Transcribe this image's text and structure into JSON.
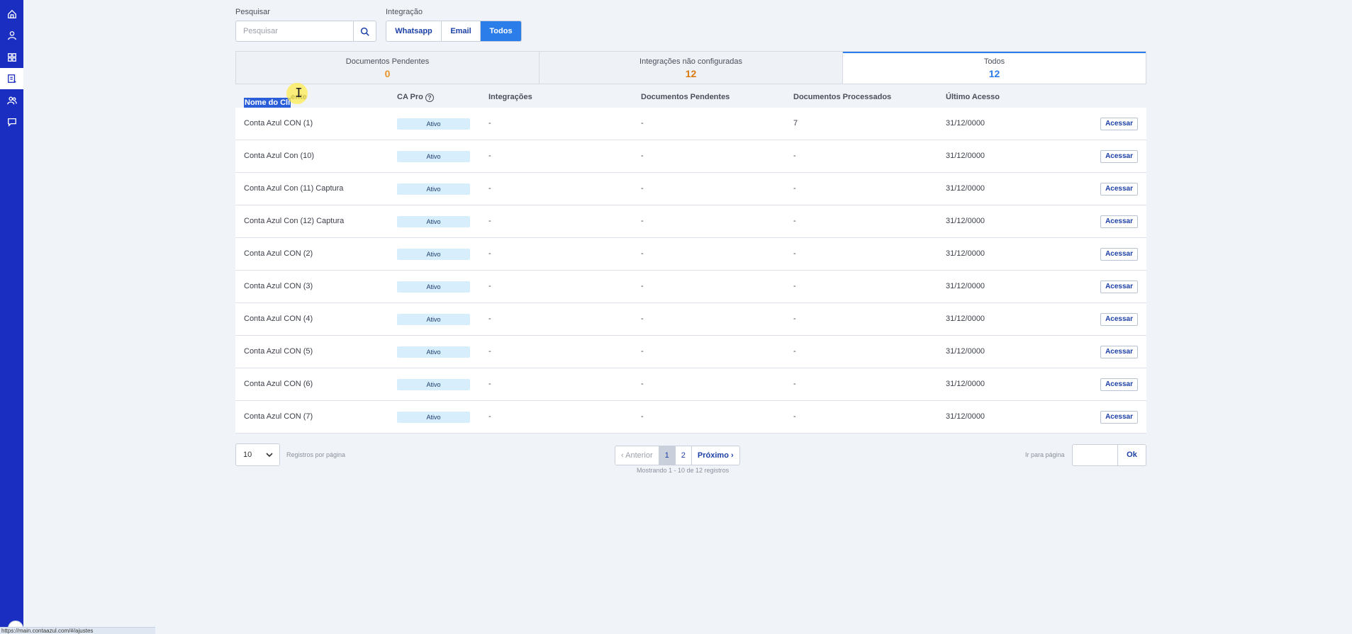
{
  "colors": {
    "sidebar": "#1b2ec2",
    "accent": "#2b7de9",
    "pending_count": "#e8942c",
    "unconfigured_count": "#d9790f",
    "all_count": "#2b7de9",
    "badge_bg": "#d7eefc"
  },
  "sidebar": {
    "items": [
      {
        "icon": "home-icon"
      },
      {
        "icon": "user-icon"
      },
      {
        "icon": "grid-icon"
      },
      {
        "icon": "document-list-icon",
        "active": true
      },
      {
        "icon": "users-icon"
      },
      {
        "icon": "chat-icon"
      }
    ]
  },
  "filters": {
    "search_label": "Pesquisar",
    "search_placeholder": "Pesquisar",
    "integration_label": "Integração",
    "integration_options": [
      {
        "label": "Whatsapp",
        "active": false
      },
      {
        "label": "Email",
        "active": false
      },
      {
        "label": "Todos",
        "active": true
      }
    ]
  },
  "tabs": [
    {
      "title": "Documentos Pendentes",
      "count": "0",
      "active": false
    },
    {
      "title": "Integrações não configuradas",
      "count": "12",
      "active": false
    },
    {
      "title": "Todos",
      "count": "12",
      "active": true
    }
  ],
  "table": {
    "headers": {
      "name_selected": "Nome do Cli",
      "name_rest": "ente",
      "ca_pro": "CA Pro",
      "integracoes": "Integrações",
      "pendentes": "Documentos Pendentes",
      "processados": "Documentos Processados",
      "ultimo_acesso": "Último Acesso"
    },
    "action_label": "Acessar",
    "rows": [
      {
        "name": "Conta Azul CON (1)",
        "ca_pro": "Ativo",
        "integracoes": "-",
        "pendentes": "-",
        "processados": "7",
        "ultimo_acesso": "31/12/0000"
      },
      {
        "name": "Conta Azul Con (10)",
        "ca_pro": "Ativo",
        "integracoes": "-",
        "pendentes": "-",
        "processados": "-",
        "ultimo_acesso": "31/12/0000"
      },
      {
        "name": "Conta Azul Con (11) Captura",
        "ca_pro": "Ativo",
        "integracoes": "-",
        "pendentes": "-",
        "processados": "-",
        "ultimo_acesso": "31/12/0000"
      },
      {
        "name": "Conta Azul Con (12) Captura",
        "ca_pro": "Ativo",
        "integracoes": "-",
        "pendentes": "-",
        "processados": "-",
        "ultimo_acesso": "31/12/0000"
      },
      {
        "name": "Conta Azul CON (2)",
        "ca_pro": "Ativo",
        "integracoes": "-",
        "pendentes": "-",
        "processados": "-",
        "ultimo_acesso": "31/12/0000"
      },
      {
        "name": "Conta Azul CON (3)",
        "ca_pro": "Ativo",
        "integracoes": "-",
        "pendentes": "-",
        "processados": "-",
        "ultimo_acesso": "31/12/0000"
      },
      {
        "name": "Conta Azul CON (4)",
        "ca_pro": "Ativo",
        "integracoes": "-",
        "pendentes": "-",
        "processados": "-",
        "ultimo_acesso": "31/12/0000"
      },
      {
        "name": "Conta Azul CON (5)",
        "ca_pro": "Ativo",
        "integracoes": "-",
        "pendentes": "-",
        "processados": "-",
        "ultimo_acesso": "31/12/0000"
      },
      {
        "name": "Conta Azul CON (6)",
        "ca_pro": "Ativo",
        "integracoes": "-",
        "pendentes": "-",
        "processados": "-",
        "ultimo_acesso": "31/12/0000"
      },
      {
        "name": "Conta Azul CON (7)",
        "ca_pro": "Ativo",
        "integracoes": "-",
        "pendentes": "-",
        "processados": "-",
        "ultimo_acesso": "31/12/0000"
      }
    ]
  },
  "footer": {
    "per_page_value": "10",
    "per_page_label": "Registros por página",
    "prev_label": "Anterior",
    "pages": [
      {
        "label": "1",
        "active": true
      },
      {
        "label": "2",
        "active": false
      }
    ],
    "next_label": "Próximo",
    "showing": "Mostrando 1 - 10 de 12 registros",
    "goto_label": "Ir para página",
    "ok_label": "Ok"
  },
  "status_bar": {
    "text": "https://main.contaazul.com/#/ajustes"
  }
}
